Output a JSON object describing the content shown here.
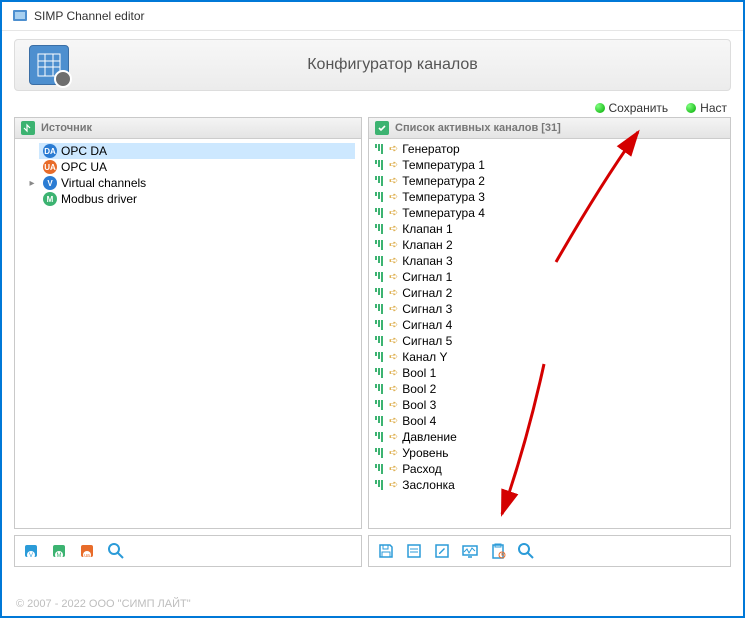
{
  "window": {
    "title": "SIMP Channel editor"
  },
  "header": {
    "title": "Конфигуратор каналов"
  },
  "actions": {
    "save": "Сохранить",
    "settings": "Наст"
  },
  "left_panel": {
    "title": "Источник",
    "items": [
      {
        "label": "OPC DA",
        "icon": "da",
        "selected": true
      },
      {
        "label": "OPC UA",
        "icon": "ua"
      },
      {
        "label": "Virtual channels",
        "icon": "v",
        "expandable": true
      },
      {
        "label": "Modbus driver",
        "icon": "m"
      }
    ]
  },
  "right_panel": {
    "title": "Список активных каналов [31]",
    "items": [
      "Генератор",
      "Температура 1",
      "Температура 2",
      "Температура 3",
      "Температура 4",
      "Клапан 1",
      "Клапан 2",
      "Клапан 3",
      "Сигнал 1",
      "Сигнал 2",
      "Сигнал 3",
      "Сигнал 4",
      "Сигнал 5",
      "Канал Y",
      "Bool 1",
      "Bool 2",
      "Bool 3",
      "Bool 4",
      "Давление",
      "Уровень",
      "Расход",
      "Заслонка"
    ]
  },
  "left_toolbar": {
    "btn1": "virtual-channels-icon",
    "btn2": "modbus-icon",
    "btn3": "opc-icon",
    "btn4": "search-icon"
  },
  "right_toolbar": {
    "btn1": "save-icon",
    "btn2": "properties-icon",
    "btn3": "edit-icon",
    "btn4": "monitor-icon",
    "btn5": "clipboard-icon",
    "btn6": "search-icon"
  },
  "footer": "© 2007 - 2022  ООО \"СИМП ЛАЙТ\"",
  "colors": {
    "accent": "#2b9bd8",
    "green": "#3cb371",
    "orange": "#e86c2a"
  }
}
